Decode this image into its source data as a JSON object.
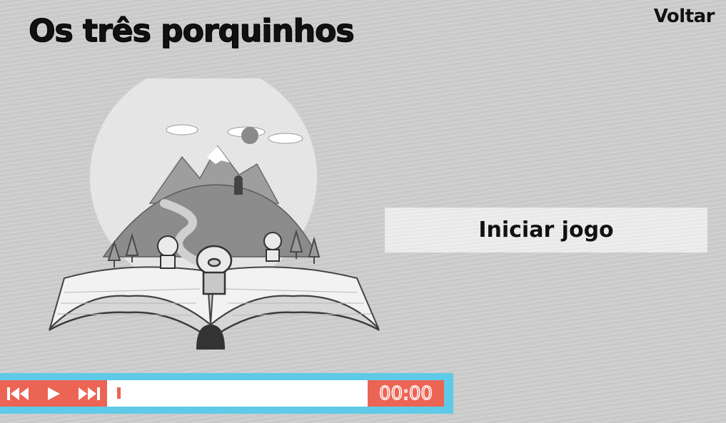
{
  "header": {
    "title": "Os três porquinhos",
    "back_label": "Voltar"
  },
  "main": {
    "start_label": "Iniciar jogo"
  },
  "player": {
    "time": "00:00",
    "progress": 0,
    "colors": {
      "frame": "#5ecae8",
      "controls": "#ec6453",
      "track": "#ffffff"
    },
    "icons": [
      "skip-back-icon",
      "play-icon",
      "skip-forward-icon"
    ]
  }
}
